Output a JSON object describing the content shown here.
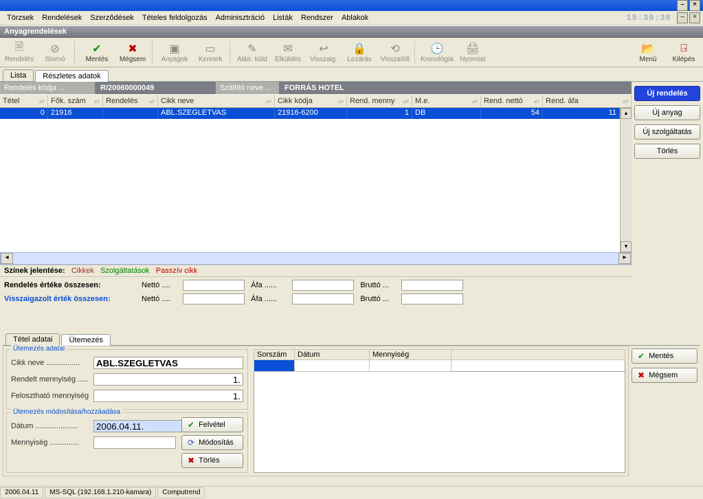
{
  "window": {
    "time": "15:30:36"
  },
  "menus": [
    "Törzsek",
    "Rendelések",
    "Szerződések",
    "Tételes feldolgozás",
    "Adminisztráció",
    "Listák",
    "Rendszer",
    "Ablakok"
  ],
  "section_title": "Anyagrendelések",
  "toolbar": {
    "rendeles": "Rendelés",
    "storno": "Stornó",
    "mentes": "Mentés",
    "megsem": "Mégsem",
    "anyagok": "Anyagok",
    "keretek": "Keretek",
    "alair": "Aláír. küld",
    "elkuldes": "Elküldés",
    "visszaig": "Visszaig.",
    "lezaras": "Lezárás",
    "visszatolt": "Visszatölt",
    "kronologia": "Kronológia",
    "nyomtat": "Nyomtat",
    "menu": "Menü",
    "kilepes": "Kilépés"
  },
  "tabs_top": {
    "lista": "Lista",
    "reszletes": "Részletes adatok"
  },
  "info": {
    "kod_lbl": "Rendelés kódja ...",
    "kod_val": "R/20060000049",
    "szall_lbl": "Szállító neve ...",
    "szall_val": "FORRÁS HOTEL"
  },
  "grid": {
    "headers": [
      "Tétel",
      "Fők. szám",
      "Rendelés",
      "Cikk neve",
      "Cikk kódja",
      "Rend. menny",
      "M.e.",
      "Rend. nettó",
      "Rend. áfa"
    ],
    "row": {
      "tetel": "0",
      "foksz": "21916",
      "rendeles": "",
      "cikknev": "ABL.SZEGLETVAS",
      "cikkkod": "21916-6200",
      "menny": "1",
      "me": "DB",
      "netto": "54",
      "afa": "11"
    }
  },
  "sidebuttons": {
    "uj_rendeles": "Új rendelés",
    "uj_anyag": "Új anyag",
    "uj_szolg": "Új szolgáltatás",
    "torles": "Törlés"
  },
  "legend": {
    "title": "Színek jelentése:",
    "c1": "Cikkek",
    "c2": "Szolgáltatások",
    "c3": "Passzív cikk"
  },
  "sums": {
    "l1": "Rendelés értéke összesen:",
    "l2": "Visszaigazolt érték összesen:",
    "netto": "Nettó ....",
    "afa": "Áfa ......",
    "brutto": "Bruttó ..."
  },
  "tabs_bottom": {
    "tetel": "Tétel adatai",
    "utem": "Ütemezés"
  },
  "sched": {
    "group1": "Ütemezés adatai",
    "group2": "Ütemezés módosítása/hozzáadása",
    "cikk_lbl": "Cikk neve ................",
    "cikk_val": "ABL.SZEGLETVAS",
    "rendelt_lbl": "Rendelt mennyiség .....",
    "rendelt_val": "1.",
    "feloszt_lbl": "Felosztható mennyiség",
    "feloszt_val": "1.",
    "datum_lbl": "Dátum ....................",
    "datum_val": "2006.04.11.",
    "menny_lbl": "Mennyiség ..............",
    "tbl": [
      "Sorszám",
      "Dátum",
      "Mennyiség"
    ],
    "felvetel": "Felvétel",
    "modositas": "Módosítás",
    "torles": "Törlés"
  },
  "save": {
    "mentes": "Mentés",
    "megsem": "Mégsem"
  },
  "status": {
    "date": "2006.04.11",
    "db": "MS-SQL (192.168.1.210-kamara)",
    "vendor": "Computrend"
  }
}
